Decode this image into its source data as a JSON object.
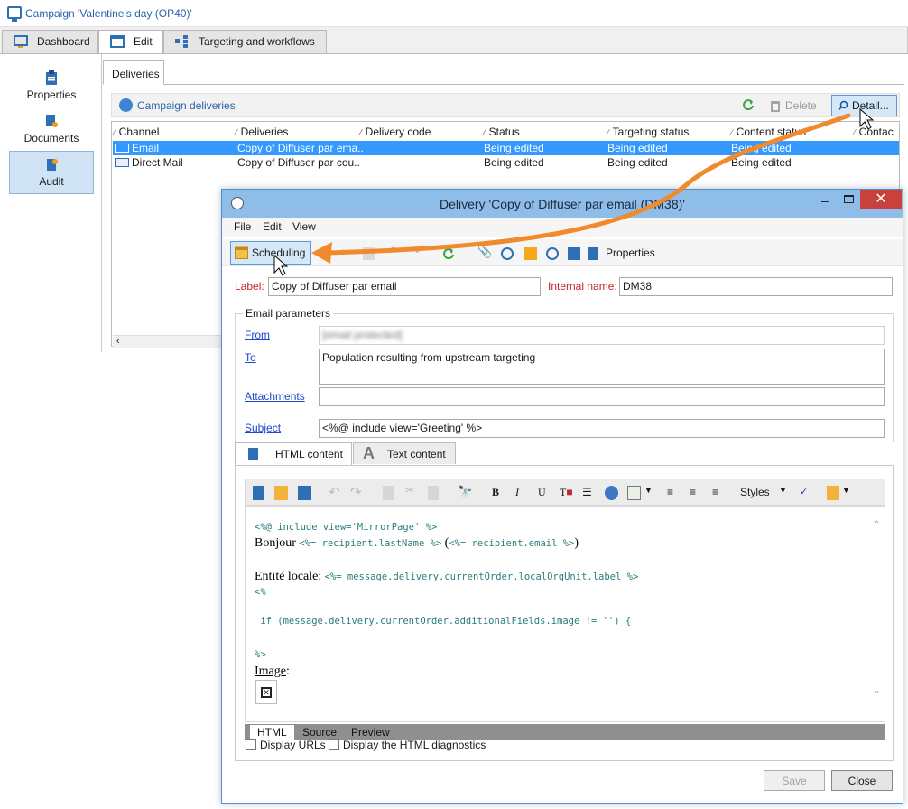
{
  "window": {
    "title": "Campaign 'Valentine's day (OP40)'"
  },
  "tabs": [
    {
      "label": "Dashboard"
    },
    {
      "label": "Edit"
    },
    {
      "label": "Targeting and workflows"
    }
  ],
  "nav": [
    {
      "label": "Properties"
    },
    {
      "label": "Documents"
    },
    {
      "label": "Audit"
    }
  ],
  "subtab": "Deliveries",
  "deliveries_toolbar": {
    "title": "Campaign deliveries",
    "delete": "Delete",
    "detail": "Detail..."
  },
  "grid": {
    "columns": [
      "Channel",
      "Deliveries",
      "Delivery code",
      "Status",
      "Targeting status",
      "Content status",
      "Contac"
    ],
    "rows": [
      [
        "Email",
        "Copy of Diffuser par ema..",
        "",
        "Being edited",
        "Being edited",
        "Being edited"
      ],
      [
        "Direct Mail",
        "Copy of Diffuser par cou..",
        "",
        "Being edited",
        "Being edited",
        "Being edited"
      ]
    ]
  },
  "dialog": {
    "title": "Delivery 'Copy of Diffuser par email (DM38)'",
    "menu": [
      "File",
      "Edit",
      "View"
    ],
    "toolbar": {
      "scheduling": "Scheduling",
      "properties": "Properties"
    },
    "label_field": {
      "label": "Label:",
      "value": "Copy of Diffuser par email"
    },
    "internal_name": {
      "label": "Internal name:",
      "value": "DM38"
    },
    "email_params": {
      "legend": "Email parameters",
      "from_label": "From",
      "from_value": "[email protected]",
      "to_label": "To",
      "to_value": "Population resulting from upstream targeting",
      "attachments_label": "Attachments",
      "subject_label": "Subject",
      "subject_value": "<%@ include view='Greeting' %>"
    },
    "content_tabs": [
      "HTML content",
      "Text content"
    ],
    "editor": {
      "styles": "Styles",
      "lines": [
        "<%@ include view='MirrorPage' %>",
        "Bonjour",
        "<%= recipient.lastName %>",
        "(",
        "<%= recipient.email %>",
        ")",
        "Entité locale",
        ":",
        "<%= message.delivery.currentOrder.localOrgUnit.label %>",
        "<%",
        " if (message.delivery.currentOrder.additionalFields.image != '') {",
        "%>",
        "Image",
        ":"
      ]
    },
    "modes": [
      "HTML",
      "Source",
      "Preview"
    ],
    "checkboxes": [
      "Display URLs",
      "Display the HTML diagnostics"
    ],
    "buttons": {
      "save": "Save",
      "close": "Close"
    }
  },
  "colors": {
    "accent": "#3399ff",
    "arrow": "#f08a2c",
    "link": "#1f47c9",
    "required": "#c0272d"
  }
}
